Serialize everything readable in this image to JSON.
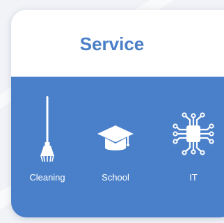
{
  "card": {
    "title": "Service"
  },
  "services": [
    {
      "label": "Cleaning",
      "icon": "broom-icon"
    },
    {
      "label": "School",
      "icon": "graduation-cap-icon"
    },
    {
      "label": "IT",
      "icon": "circuit-chip-icon"
    }
  ],
  "colors": {
    "accent": "#4a7fc8",
    "panel": "#4a80c9",
    "card": "#ffffff",
    "page": "#f1f3f7"
  }
}
